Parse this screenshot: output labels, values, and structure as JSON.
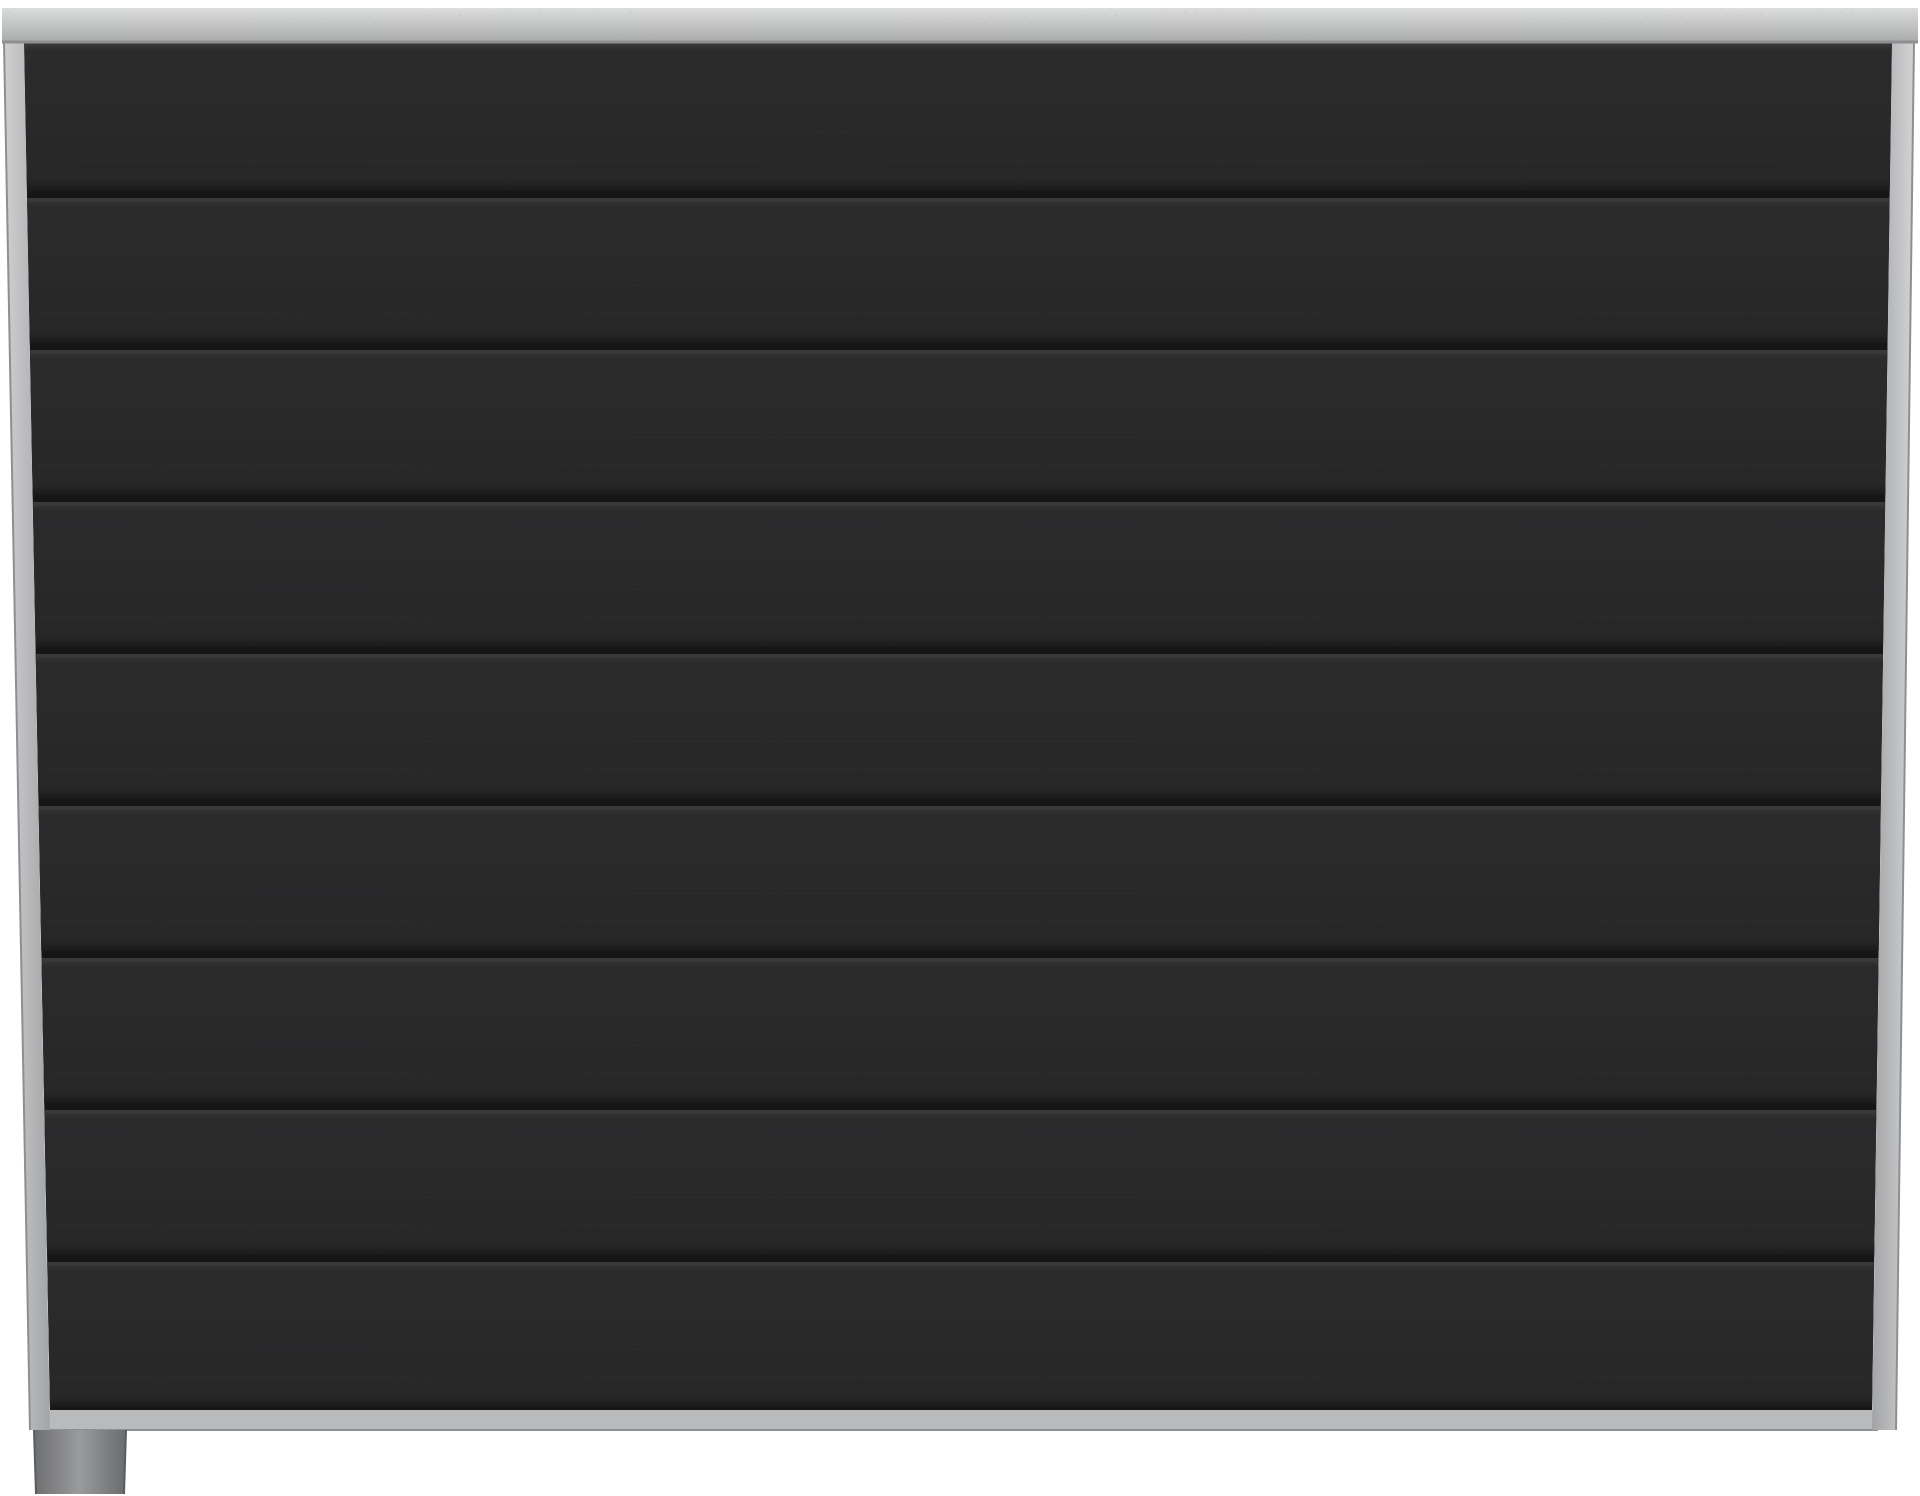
{
  "scene": {
    "subject": "fence-panel",
    "board_count": 9,
    "colors": {
      "background": "#ffffff",
      "board": "#2a2a2b",
      "board_highlight": "#3a3a3b",
      "board_shadow": "#161617",
      "frame": "#b9babb",
      "frame_light": "#d6d7d8",
      "frame_dark": "#8e8f91",
      "cap_top": "#cfd0d1",
      "post": "#8b8c8e"
    }
  }
}
